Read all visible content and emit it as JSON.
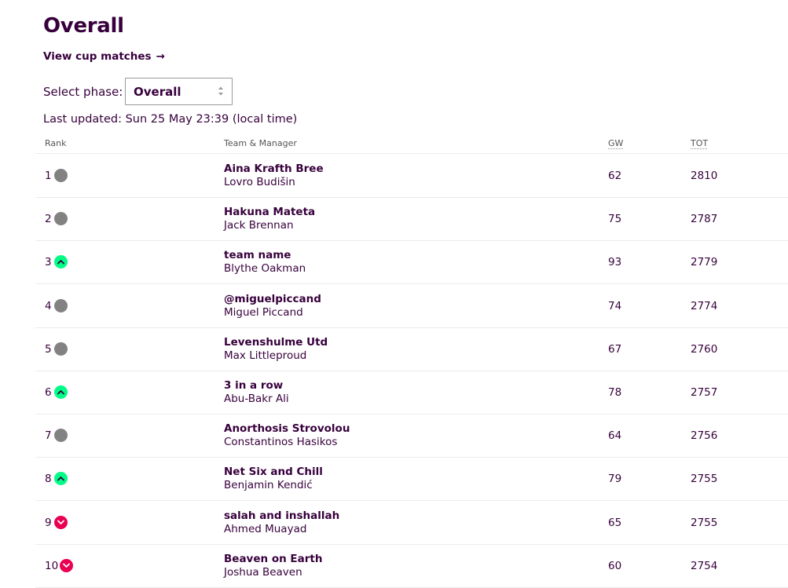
{
  "page": {
    "title": "Overall",
    "cup_link_label": "View cup matches",
    "cup_link_arrow": "→",
    "phase_label": "Select phase:",
    "phase_selected": "Overall",
    "last_updated": "Last updated: Sun 25 May 23:39 (local time)"
  },
  "table": {
    "headers": {
      "rank": "Rank",
      "team": "Team & Manager",
      "gw": "GW",
      "tot": "TOT"
    },
    "rows": [
      {
        "rank": "1",
        "movement": "same",
        "team": "Aina Krafth Bree",
        "manager": "Lovro Budišin",
        "gw": "62",
        "tot": "2810"
      },
      {
        "rank": "2",
        "movement": "same",
        "team": "Hakuna Mateta",
        "manager": "Jack Brennan",
        "gw": "75",
        "tot": "2787"
      },
      {
        "rank": "3",
        "movement": "up",
        "team": "team name",
        "manager": "Blythe Oakman",
        "gw": "93",
        "tot": "2779"
      },
      {
        "rank": "4",
        "movement": "same",
        "team": "@miguelpiccand",
        "manager": "Miguel Piccand",
        "gw": "74",
        "tot": "2774"
      },
      {
        "rank": "5",
        "movement": "same",
        "team": "Levenshulme Utd",
        "manager": "Max Littleproud",
        "gw": "67",
        "tot": "2760"
      },
      {
        "rank": "6",
        "movement": "up",
        "team": "3 in a row",
        "manager": "Abu-Bakr Ali",
        "gw": "78",
        "tot": "2757"
      },
      {
        "rank": "7",
        "movement": "same",
        "team": "Anorthosis Strovolou",
        "manager": "Constantinos Hasikos",
        "gw": "64",
        "tot": "2756"
      },
      {
        "rank": "8",
        "movement": "up",
        "team": "Net Six and Chill",
        "manager": "Benjamin Kendić",
        "gw": "79",
        "tot": "2755"
      },
      {
        "rank": "9",
        "movement": "down",
        "team": "salah and inshallah",
        "manager": "Ahmed Muayad",
        "gw": "65",
        "tot": "2755"
      },
      {
        "rank": "10",
        "movement": "down",
        "team": "Beaven on Earth",
        "manager": "Joshua Beaven",
        "gw": "60",
        "tot": "2754"
      }
    ]
  },
  "colors": {
    "brand": "#37003c",
    "up": "#00fc87",
    "down": "#e90052",
    "same": "#828282"
  }
}
